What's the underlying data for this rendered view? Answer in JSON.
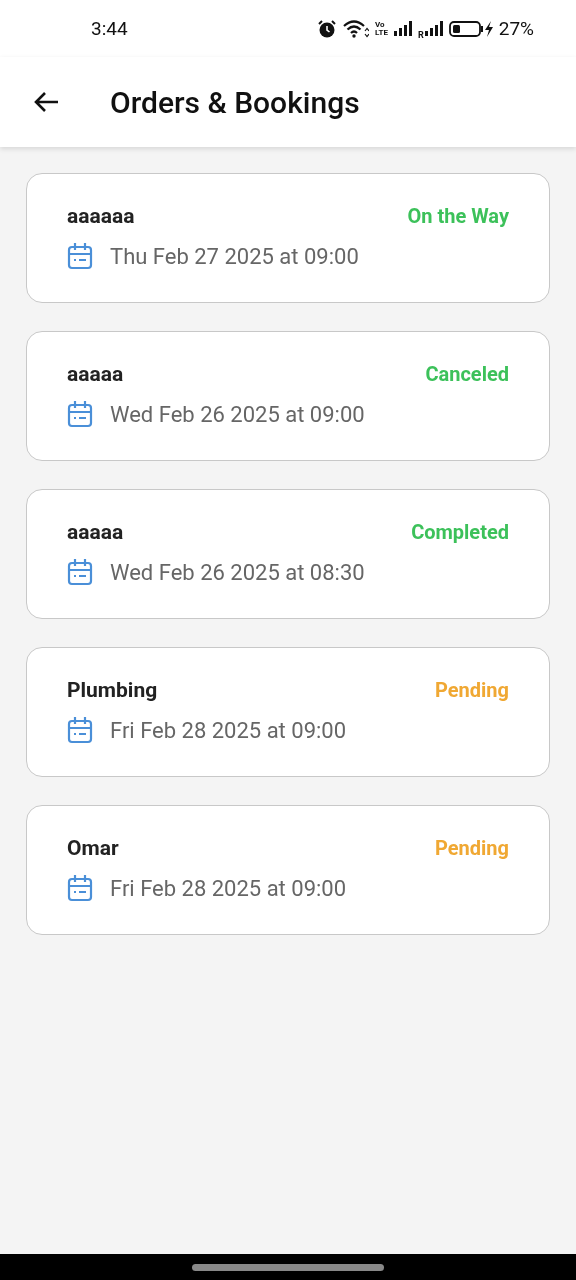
{
  "status_bar": {
    "time": "3:44",
    "volte_top": "Vo",
    "volte_bottom": "LTE",
    "roaming": "R",
    "battery": "27%"
  },
  "header": {
    "title": "Orders & Bookings"
  },
  "orders": [
    {
      "name": "aaaaaa",
      "status": "On the Way",
      "color": "#3cc15a",
      "date": "Thu Feb 27 2025 at 09:00"
    },
    {
      "name": "aaaaa",
      "status": "Canceled",
      "color": "#3cc15a",
      "date": "Wed Feb 26 2025 at 09:00"
    },
    {
      "name": "aaaaa",
      "status": "Completed",
      "color": "#3cc15a",
      "date": "Wed Feb 26 2025 at 08:30"
    },
    {
      "name": "Plumbing",
      "status": "Pending",
      "color": "#f0a833",
      "date": "Fri Feb 28 2025 at 09:00"
    },
    {
      "name": "Omar",
      "status": "Pending",
      "color": "#f0a833",
      "date": "Fri Feb 28 2025 at 09:00"
    }
  ]
}
